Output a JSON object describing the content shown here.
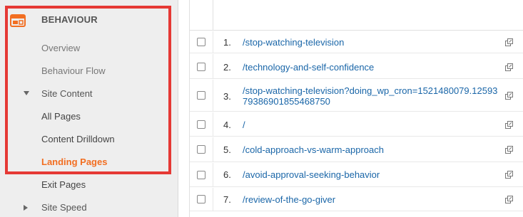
{
  "sidebar": {
    "header": {
      "label": "BEHAVIOUR",
      "icon": "behaviour-icon"
    },
    "items": [
      {
        "label": "Overview"
      },
      {
        "label": "Behaviour Flow"
      },
      {
        "label": "Site Content"
      },
      {
        "label": "All Pages"
      },
      {
        "label": "Content Drilldown"
      },
      {
        "label": "Landing Pages"
      },
      {
        "label": "Exit Pages"
      },
      {
        "label": "Site Speed"
      }
    ],
    "active_color": "#f26e21",
    "highlight_color": "#e53935"
  },
  "table": {
    "rows": [
      {
        "num": "1.",
        "page": "/stop-watching-television"
      },
      {
        "num": "2.",
        "page": "/technology-and-self-confidence"
      },
      {
        "num": "3.",
        "page": "/stop-watching-television?doing_wp_cron=1521480079.1259379386901855468750"
      },
      {
        "num": "4.",
        "page": "/"
      },
      {
        "num": "5.",
        "page": "/cold-approach-vs-warm-approach"
      },
      {
        "num": "6.",
        "page": "/avoid-approval-seeking-behavior"
      },
      {
        "num": "7.",
        "page": "/review-of-the-go-giver"
      }
    ],
    "link_color": "#1a66a8"
  }
}
